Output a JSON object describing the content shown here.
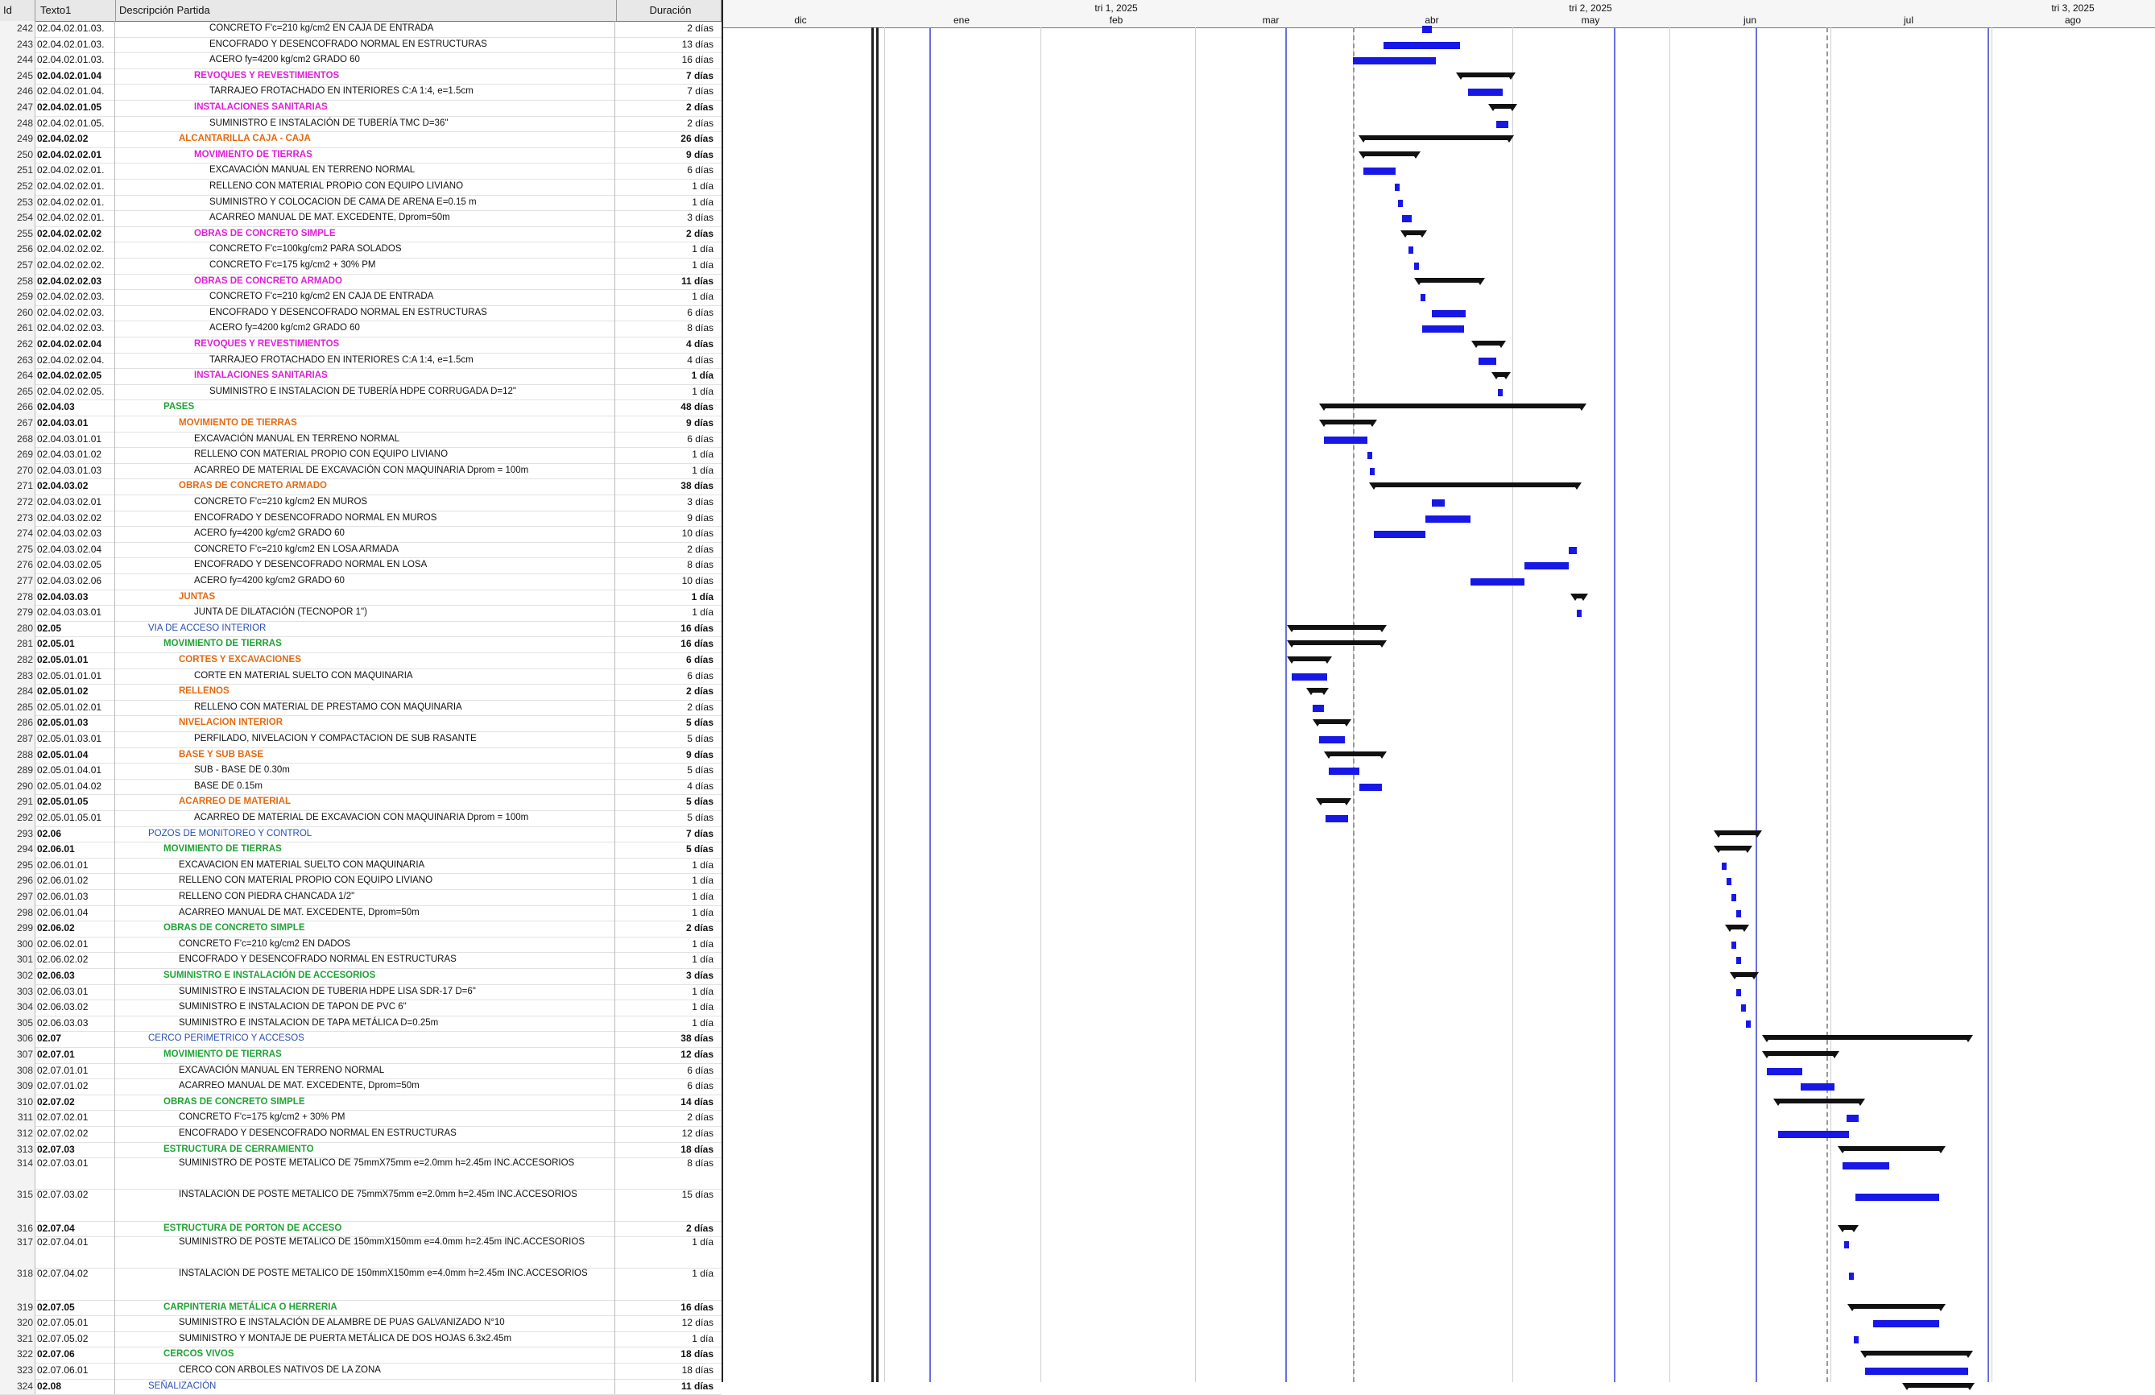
{
  "columns": {
    "id": "Id",
    "texto1": "Texto1",
    "descripcion": "Descripción Partida",
    "duracion": "Duración"
  },
  "timeline": {
    "quarters": [
      "tri 1, 2025",
      "tri 2, 2025",
      "tri 3, 2025"
    ],
    "months": [
      "dic",
      "ene",
      "feb",
      "mar",
      "abr",
      "may",
      "jun",
      "jul",
      "ago"
    ]
  },
  "rows": [
    {
      "id": "242",
      "code": "02.04.02.01.03.",
      "desc": "CONCRETO F'c=210 kg/cm2 EN CAJA DE ENTRADA",
      "dur": "2 días",
      "lvl": "task",
      "ind": 4
    },
    {
      "id": "243",
      "code": "02.04.02.01.03.",
      "desc": "ENCOFRADO Y DESENCOFRADO NORMAL EN ESTRUCTURAS",
      "dur": "13 días",
      "lvl": "task",
      "ind": 4
    },
    {
      "id": "244",
      "code": "02.04.02.01.03.",
      "desc": "ACERO fy=4200 kg/cm2 GRADO 60",
      "dur": "16 días",
      "lvl": "task",
      "ind": 4
    },
    {
      "id": "245",
      "code": "02.04.02.01.04",
      "desc": "REVOQUES Y REVESTIMIENTOS",
      "dur": "7 días",
      "lvl": "magenta",
      "ind": 3
    },
    {
      "id": "246",
      "code": "02.04.02.01.04.",
      "desc": "TARRAJEO FROTACHADO EN INTERIORES C:A 1:4, e=1.5cm",
      "dur": "7 días",
      "lvl": "task",
      "ind": 4
    },
    {
      "id": "247",
      "code": "02.04.02.01.05",
      "desc": "INSTALACIONES SANITARIAS",
      "dur": "2 días",
      "lvl": "magenta",
      "ind": 3
    },
    {
      "id": "248",
      "code": "02.04.02.01.05.",
      "desc": "SUMINISTRO E INSTALACIÓN DE TUBERÍA TMC D=36\"",
      "dur": "2 días",
      "lvl": "task",
      "ind": 4
    },
    {
      "id": "249",
      "code": "02.04.02.02",
      "desc": "ALCANTARILLA CAJA - CAJA",
      "dur": "26 días",
      "lvl": "orange",
      "ind": 2
    },
    {
      "id": "250",
      "code": "02.04.02.02.01",
      "desc": "MOVIMIENTO DE TIERRAS",
      "dur": "9 días",
      "lvl": "magenta",
      "ind": 3
    },
    {
      "id": "251",
      "code": "02.04.02.02.01.",
      "desc": "EXCAVACIÓN MANUAL EN TERRENO NORMAL",
      "dur": "6 días",
      "lvl": "task",
      "ind": 4
    },
    {
      "id": "252",
      "code": "02.04.02.02.01.",
      "desc": "RELLENO CON MATERIAL PROPIO CON EQUIPO LIVIANO",
      "dur": "1 día",
      "lvl": "task",
      "ind": 4
    },
    {
      "id": "253",
      "code": "02.04.02.02.01.",
      "desc": "SUMINISTRO Y COLOCACION DE CAMA DE ARENA E=0.15 m",
      "dur": "1 día",
      "lvl": "task",
      "ind": 4
    },
    {
      "id": "254",
      "code": "02.04.02.02.01.",
      "desc": "ACARREO MANUAL DE MAT. EXCEDENTE, Dprom=50m",
      "dur": "3 días",
      "lvl": "task",
      "ind": 4
    },
    {
      "id": "255",
      "code": "02.04.02.02.02",
      "desc": "OBRAS DE CONCRETO SIMPLE",
      "dur": "2 días",
      "lvl": "magenta",
      "ind": 3
    },
    {
      "id": "256",
      "code": "02.04.02.02.02.",
      "desc": "CONCRETO F'c=100kg/cm2 PARA SOLADOS",
      "dur": "1 día",
      "lvl": "task",
      "ind": 4
    },
    {
      "id": "257",
      "code": "02.04.02.02.02.",
      "desc": "CONCRETO F'c=175 kg/cm2 + 30% PM",
      "dur": "1 día",
      "lvl": "task",
      "ind": 4
    },
    {
      "id": "258",
      "code": "02.04.02.02.03",
      "desc": "OBRAS DE CONCRETO ARMADO",
      "dur": "11 días",
      "lvl": "magenta",
      "ind": 3
    },
    {
      "id": "259",
      "code": "02.04.02.02.03.",
      "desc": "CONCRETO F'c=210 kg/cm2 EN CAJA DE ENTRADA",
      "dur": "1 día",
      "lvl": "task",
      "ind": 4
    },
    {
      "id": "260",
      "code": "02.04.02.02.03.",
      "desc": "ENCOFRADO Y DESENCOFRADO NORMAL EN ESTRUCTURAS",
      "dur": "6 días",
      "lvl": "task",
      "ind": 4
    },
    {
      "id": "261",
      "code": "02.04.02.02.03.",
      "desc": "ACERO fy=4200 kg/cm2 GRADO 60",
      "dur": "8 días",
      "lvl": "task",
      "ind": 4
    },
    {
      "id": "262",
      "code": "02.04.02.02.04",
      "desc": "REVOQUES Y REVESTIMIENTOS",
      "dur": "4 días",
      "lvl": "magenta",
      "ind": 3
    },
    {
      "id": "263",
      "code": "02.04.02.02.04.",
      "desc": "TARRAJEO FROTACHADO EN INTERIORES C:A 1:4, e=1.5cm",
      "dur": "4 días",
      "lvl": "task",
      "ind": 4
    },
    {
      "id": "264",
      "code": "02.04.02.02.05",
      "desc": "INSTALACIONES SANITARIAS",
      "dur": "1 día",
      "lvl": "magenta",
      "ind": 3
    },
    {
      "id": "265",
      "code": "02.04.02.02.05.",
      "desc": "SUMINISTRO E INSTALACION DE TUBERÍA HDPE CORRUGADA D=12\"",
      "dur": "1 día",
      "lvl": "task",
      "ind": 4
    },
    {
      "id": "266",
      "code": "02.04.03",
      "desc": "PASES",
      "dur": "48 días",
      "lvl": "green",
      "ind": 1
    },
    {
      "id": "267",
      "code": "02.04.03.01",
      "desc": "MOVIMIENTO DE TIERRAS",
      "dur": "9 días",
      "lvl": "orange",
      "ind": 2
    },
    {
      "id": "268",
      "code": "02.04.03.01.01",
      "desc": "EXCAVACIÓN MANUAL EN TERRENO NORMAL",
      "dur": "6 días",
      "lvl": "task",
      "ind": 3
    },
    {
      "id": "269",
      "code": "02.04.03.01.02",
      "desc": "RELLENO CON MATERIAL PROPIO CON EQUIPO LIVIANO",
      "dur": "1 día",
      "lvl": "task",
      "ind": 3
    },
    {
      "id": "270",
      "code": "02.04.03.01.03",
      "desc": "ACARREO DE MATERIAL DE EXCAVACIÓN CON MAQUINARIA Dprom = 100m",
      "dur": "1 día",
      "lvl": "task",
      "ind": 3
    },
    {
      "id": "271",
      "code": "02.04.03.02",
      "desc": "OBRAS DE CONCRETO ARMADO",
      "dur": "38 días",
      "lvl": "orange",
      "ind": 2
    },
    {
      "id": "272",
      "code": "02.04.03.02.01",
      "desc": "CONCRETO F'c=210 kg/cm2 EN MUROS",
      "dur": "3 días",
      "lvl": "task",
      "ind": 3
    },
    {
      "id": "273",
      "code": "02.04.03.02.02",
      "desc": "ENCOFRADO Y DESENCOFRADO NORMAL EN MUROS",
      "dur": "9 días",
      "lvl": "task",
      "ind": 3
    },
    {
      "id": "274",
      "code": "02.04.03.02.03",
      "desc": "ACERO fy=4200 kg/cm2 GRADO 60",
      "dur": "10 días",
      "lvl": "task",
      "ind": 3
    },
    {
      "id": "275",
      "code": "02.04.03.02.04",
      "desc": "CONCRETO F'c=210 kg/cm2 EN LOSA ARMADA",
      "dur": "2 días",
      "lvl": "task",
      "ind": 3
    },
    {
      "id": "276",
      "code": "02.04.03.02.05",
      "desc": "ENCOFRADO Y DESENCOFRADO NORMAL EN LOSA",
      "dur": "8 días",
      "lvl": "task",
      "ind": 3
    },
    {
      "id": "277",
      "code": "02.04.03.02.06",
      "desc": "ACERO fy=4200 kg/cm2 GRADO 60",
      "dur": "10 días",
      "lvl": "task",
      "ind": 3
    },
    {
      "id": "278",
      "code": "02.04.03.03",
      "desc": "JUNTAS",
      "dur": "1 día",
      "lvl": "orange",
      "ind": 2
    },
    {
      "id": "279",
      "code": "02.04.03.03.01",
      "desc": "JUNTA DE DILATACIÓN (TECNOPOR 1\")",
      "dur": "1 día",
      "lvl": "task",
      "ind": 3
    },
    {
      "id": "280",
      "code": "02.05",
      "desc": "VIA DE ACCESO INTERIOR",
      "dur": "16 días",
      "lvl": "blue",
      "ind": 0
    },
    {
      "id": "281",
      "code": "02.05.01",
      "desc": "MOVIMIENTO DE TIERRAS",
      "dur": "16 días",
      "lvl": "green",
      "ind": 1
    },
    {
      "id": "282",
      "code": "02.05.01.01",
      "desc": "CORTES Y EXCAVACIONES",
      "dur": "6 días",
      "lvl": "orange",
      "ind": 2
    },
    {
      "id": "283",
      "code": "02.05.01.01.01",
      "desc": "CORTE EN MATERIAL SUELTO CON MAQUINARIA",
      "dur": "6 días",
      "lvl": "task",
      "ind": 3
    },
    {
      "id": "284",
      "code": "02.05.01.02",
      "desc": "RELLENOS",
      "dur": "2 días",
      "lvl": "orange",
      "ind": 2
    },
    {
      "id": "285",
      "code": "02.05.01.02.01",
      "desc": "RELLENO CON MATERIAL DE PRESTAMO CON MAQUINARIA",
      "dur": "2 días",
      "lvl": "task",
      "ind": 3
    },
    {
      "id": "286",
      "code": "02.05.01.03",
      "desc": "NIVELACION INTERIOR",
      "dur": "5 días",
      "lvl": "orange",
      "ind": 2
    },
    {
      "id": "287",
      "code": "02.05.01.03.01",
      "desc": "PERFILADO, NIVELACION Y COMPACTACION DE SUB RASANTE",
      "dur": "5 días",
      "lvl": "task",
      "ind": 3
    },
    {
      "id": "288",
      "code": "02.05.01.04",
      "desc": "BASE Y SUB BASE",
      "dur": "9 días",
      "lvl": "orange",
      "ind": 2
    },
    {
      "id": "289",
      "code": "02.05.01.04.01",
      "desc": "SUB - BASE DE 0.30m",
      "dur": "5 días",
      "lvl": "task",
      "ind": 3
    },
    {
      "id": "290",
      "code": "02.05.01.04.02",
      "desc": "BASE DE 0.15m",
      "dur": "4 días",
      "lvl": "task",
      "ind": 3
    },
    {
      "id": "291",
      "code": "02.05.01.05",
      "desc": "ACARREO DE MATERIAL",
      "dur": "5 días",
      "lvl": "orange",
      "ind": 2
    },
    {
      "id": "292",
      "code": "02.05.01.05.01",
      "desc": "ACARREO DE MATERIAL DE EXCAVACION CON MAQUINARIA Dprom = 100m",
      "dur": "5 días",
      "lvl": "task",
      "ind": 3
    },
    {
      "id": "293",
      "code": "02.06",
      "desc": "POZOS DE MONITOREO Y CONTROL",
      "dur": "7 días",
      "lvl": "blue",
      "ind": 0
    },
    {
      "id": "294",
      "code": "02.06.01",
      "desc": "MOVIMIENTO DE TIERRAS",
      "dur": "5 días",
      "lvl": "green",
      "ind": 1
    },
    {
      "id": "295",
      "code": "02.06.01.01",
      "desc": "EXCAVACION EN MATERIAL SUELTO CON MAQUINARIA",
      "dur": "1 día",
      "lvl": "task",
      "ind": 2
    },
    {
      "id": "296",
      "code": "02.06.01.02",
      "desc": "RELLENO CON MATERIAL PROPIO CON EQUIPO LIVIANO",
      "dur": "1 día",
      "lvl": "task",
      "ind": 2
    },
    {
      "id": "297",
      "code": "02.06.01.03",
      "desc": "RELLENO CON PIEDRA CHANCADA 1/2\"",
      "dur": "1 día",
      "lvl": "task",
      "ind": 2
    },
    {
      "id": "298",
      "code": "02.06.01.04",
      "desc": "ACARREO MANUAL DE MAT. EXCEDENTE, Dprom=50m",
      "dur": "1 día",
      "lvl": "task",
      "ind": 2
    },
    {
      "id": "299",
      "code": "02.06.02",
      "desc": "OBRAS DE CONCRETO SIMPLE",
      "dur": "2 días",
      "lvl": "green",
      "ind": 1
    },
    {
      "id": "300",
      "code": "02.06.02.01",
      "desc": "CONCRETO F'c=210 kg/cm2 EN DADOS",
      "dur": "1 día",
      "lvl": "task",
      "ind": 2
    },
    {
      "id": "301",
      "code": "02.06.02.02",
      "desc": "ENCOFRADO Y DESENCOFRADO NORMAL EN ESTRUCTURAS",
      "dur": "1 día",
      "lvl": "task",
      "ind": 2
    },
    {
      "id": "302",
      "code": "02.06.03",
      "desc": "SUMINISTRO E INSTALACIÓN DE ACCESORIOS",
      "dur": "3 días",
      "lvl": "green",
      "ind": 1
    },
    {
      "id": "303",
      "code": "02.06.03.01",
      "desc": "SUMINISTRO E INSTALACION DE TUBERIA HDPE LISA SDR-17 D=6\"",
      "dur": "1 día",
      "lvl": "task",
      "ind": 2
    },
    {
      "id": "304",
      "code": "02.06.03.02",
      "desc": "SUMINISTRO E INSTALACION DE TAPON DE PVC 6\"",
      "dur": "1 día",
      "lvl": "task",
      "ind": 2
    },
    {
      "id": "305",
      "code": "02.06.03.03",
      "desc": "SUMINISTRO E INSTALACION DE TAPA METÁLICA D=0.25m",
      "dur": "1 día",
      "lvl": "task",
      "ind": 2
    },
    {
      "id": "306",
      "code": "02.07",
      "desc": "CERCO PERIMETRICO Y ACCESOS",
      "dur": "38 días",
      "lvl": "blue",
      "ind": 0
    },
    {
      "id": "307",
      "code": "02.07.01",
      "desc": "MOVIMIENTO DE TIERRAS",
      "dur": "12 días",
      "lvl": "green",
      "ind": 1
    },
    {
      "id": "308",
      "code": "02.07.01.01",
      "desc": "EXCAVACIÓN MANUAL EN TERRENO NORMAL",
      "dur": "6 días",
      "lvl": "task",
      "ind": 2
    },
    {
      "id": "309",
      "code": "02.07.01.02",
      "desc": "ACARREO MANUAL DE MAT. EXCEDENTE, Dprom=50m",
      "dur": "6 días",
      "lvl": "task",
      "ind": 2
    },
    {
      "id": "310",
      "code": "02.07.02",
      "desc": "OBRAS DE CONCRETO SIMPLE",
      "dur": "14 días",
      "lvl": "green",
      "ind": 1
    },
    {
      "id": "311",
      "code": "02.07.02.01",
      "desc": "CONCRETO F'c=175 kg/cm2 + 30% PM",
      "dur": "2 días",
      "lvl": "task",
      "ind": 2
    },
    {
      "id": "312",
      "code": "02.07.02.02",
      "desc": "ENCOFRADO Y DESENCOFRADO NORMAL EN ESTRUCTURAS",
      "dur": "12 días",
      "lvl": "task",
      "ind": 2
    },
    {
      "id": "313",
      "code": "02.07.03",
      "desc": "ESTRUCTURA DE CERRAMIENTO",
      "dur": "18 días",
      "lvl": "green",
      "ind": 1
    },
    {
      "id": "314",
      "code": "02.07.03.01",
      "desc": "SUMINISTRO DE POSTE METALICO DE 75mmX75mm e=2.0mm h=2.45m INC.ACCESORIOS",
      "dur": "8 días",
      "lvl": "task",
      "ind": 2,
      "tall": true
    },
    {
      "id": "315",
      "code": "02.07.03.02",
      "desc": "INSTALACIÓN DE POSTE METALICO DE 75mmX75mm e=2.0mm h=2.45m INC.ACCESORIOS",
      "dur": "15 días",
      "lvl": "task",
      "ind": 2,
      "tall": true
    },
    {
      "id": "316",
      "code": "02.07.04",
      "desc": "ESTRUCTURA DE PORTON DE ACCESO",
      "dur": "2 días",
      "lvl": "green",
      "ind": 1
    },
    {
      "id": "317",
      "code": "02.07.04.01",
      "desc": "SUMINISTRO DE POSTE METALICO DE 150mmX150mm e=4.0mm h=2.45m INC.ACCESORIOS",
      "dur": "1 día",
      "lvl": "task",
      "ind": 2,
      "tall": true
    },
    {
      "id": "318",
      "code": "02.07.04.02",
      "desc": "INSTALACIÓN DE POSTE METALICO DE 150mmX150mm e=4.0mm h=2.45m INC.ACCESORIOS",
      "dur": "1 día",
      "lvl": "task",
      "ind": 2,
      "tall": true
    },
    {
      "id": "319",
      "code": "02.07.05",
      "desc": "CARPINTERIA METÁLICA O HERRERIA",
      "dur": "16 días",
      "lvl": "green",
      "ind": 1
    },
    {
      "id": "320",
      "code": "02.07.05.01",
      "desc": "SUMINISTRO E INSTALACIÓN DE ALAMBRE DE PUAS GALVANIZADO N°10",
      "dur": "12 días",
      "lvl": "task",
      "ind": 2
    },
    {
      "id": "321",
      "code": "02.07.05.02",
      "desc": "SUMINISTRO Y MONTAJE DE PUERTA METÁLICA DE DOS HOJAS 6.3x2.45m",
      "dur": "1 día",
      "lvl": "task",
      "ind": 2
    },
    {
      "id": "322",
      "code": "02.07.06",
      "desc": "CERCOS VIVOS",
      "dur": "18 días",
      "lvl": "green",
      "ind": 1
    },
    {
      "id": "323",
      "code": "02.07.06.01",
      "desc": "CERCO CON ARBOLES NATIVOS DE LA ZONA",
      "dur": "18 días",
      "lvl": "task",
      "ind": 2
    },
    {
      "id": "324",
      "code": "02.08",
      "desc": "SEÑALIZACIÓN",
      "dur": "11 días",
      "lvl": "blue",
      "ind": 0
    }
  ]
}
